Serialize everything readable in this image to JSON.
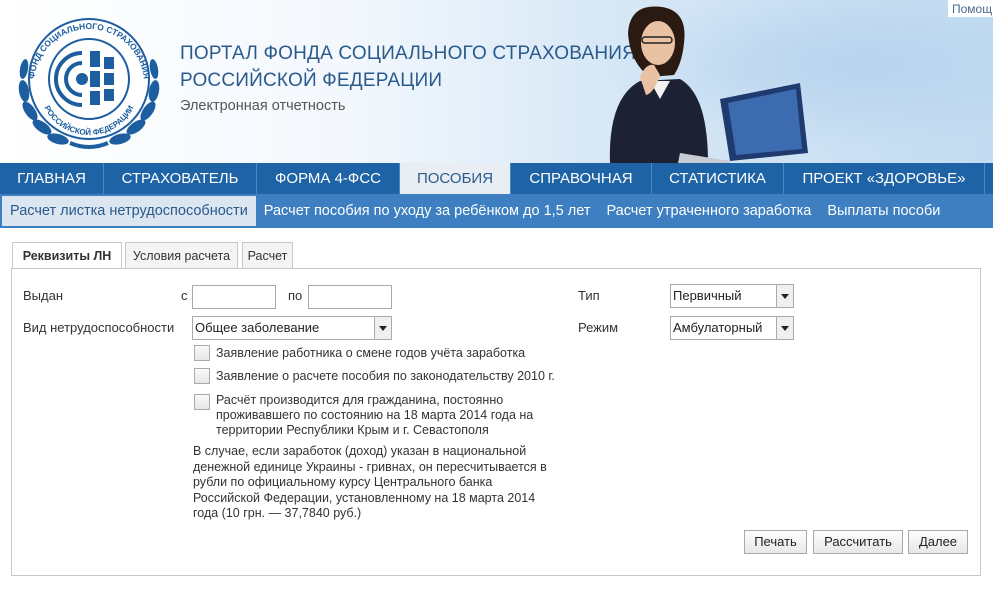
{
  "header": {
    "title_line1": "ПОРТАЛ ФОНДА СОЦИАЛЬНОГО СТРАХОВАНИЯ",
    "title_line2": "РОССИЙСКОЙ ФЕДЕРАЦИИ",
    "subtitle": "Электронная отчетность",
    "help_link": "Помощ",
    "logo_text_top": "ФОНД СОЦИАЛЬНОГО СТРАХОВАНИЯ",
    "logo_text_bottom": "РОССИЙСКОЙ ФЕДЕРАЦИИ"
  },
  "main_nav": {
    "items": [
      {
        "label": "ГЛАВНАЯ"
      },
      {
        "label": "СТРАХОВАТЕЛЬ"
      },
      {
        "label": "ФОРМА 4-ФСС"
      },
      {
        "label": "ПОСОБИЯ"
      },
      {
        "label": "СПРАВОЧНАЯ"
      },
      {
        "label": "СТАТИСТИКА"
      },
      {
        "label": "ПРОЕКТ «ЗДОРОВЬЕ»"
      }
    ],
    "active": "ПОСОБИЯ"
  },
  "sub_nav": {
    "items": [
      {
        "label": "Расчет листка нетрудоспособности"
      },
      {
        "label": "Расчет пособия по уходу за ребёнком до 1,5 лет"
      },
      {
        "label": "Расчет утраченного заработка"
      },
      {
        "label": "Выплаты пособи"
      }
    ],
    "active": "Расчет листка нетрудоспособности"
  },
  "tabs": [
    {
      "label": "Реквизиты ЛН"
    },
    {
      "label": "Условия расчета"
    },
    {
      "label": "Расчет"
    }
  ],
  "form": {
    "issued_label": "Выдан",
    "from_label": "с",
    "to_label": "по",
    "from_value": "",
    "to_value": "",
    "disability_type_label": "Вид нетрудоспособности",
    "disability_type_value": "Общее заболевание",
    "type_label": "Тип",
    "type_value": "Первичный",
    "mode_label": "Режим",
    "mode_value": "Амбулаторный",
    "checkbox1": "Заявление работника о смене годов учёта заработка",
    "checkbox2": "Заявление о расчете пособия по законодательству 2010 г.",
    "checkbox3_line1": "Расчёт производится для гражданина, постоянно",
    "checkbox3_line2": "проживавшего по состоянию на 18 марта 2014 года на",
    "checkbox3_line3": "территории Республики Крым и г. Севастополя",
    "note_line1": "В случае, если заработок (доход) указан в национальной",
    "note_line2": "денежной единице Украины - гривнах, он пересчитывается в",
    "note_line3": "рубли по официальному курсу Центрального банка",
    "note_line4": "Российской Федерации, установленному на 18 марта 2014",
    "note_line5": "года (10 грн. — 37,7840 руб.)"
  },
  "buttons": {
    "print": "Печать",
    "calculate": "Рассчитать",
    "next": "Далее"
  },
  "colors": {
    "main_nav_bg": "#1d63a5",
    "sub_nav_bg": "#3d7fc0",
    "title_color": "#2a5a8c"
  }
}
